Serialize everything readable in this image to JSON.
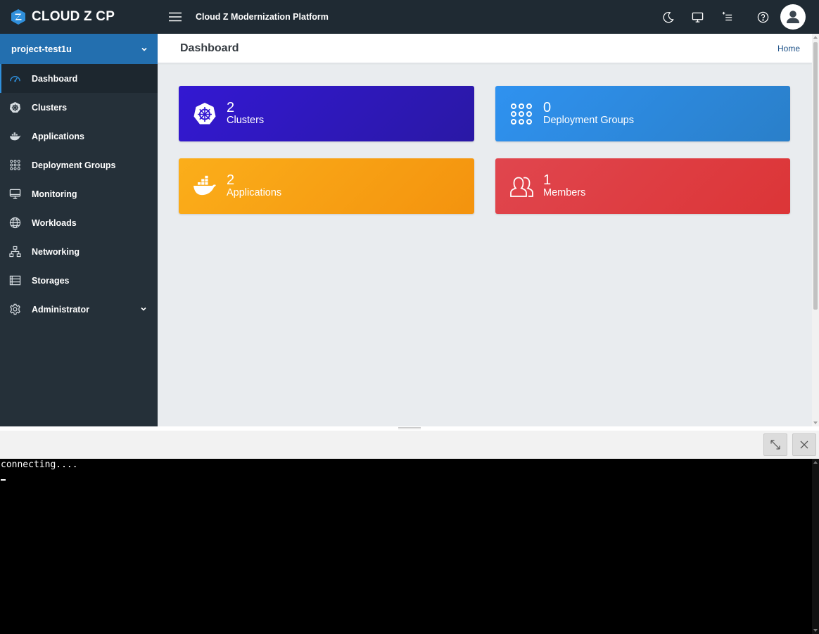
{
  "brand": {
    "name": "CLOUD Z CP",
    "logo_letter": "Z",
    "logo_color": "#2f8fdb"
  },
  "sidebar": {
    "project": {
      "label": "project-test1u"
    },
    "items": [
      {
        "label": "Dashboard",
        "icon": "gauge-icon",
        "active": true
      },
      {
        "label": "Clusters",
        "icon": "kubernetes-icon"
      },
      {
        "label": "Applications",
        "icon": "docker-icon"
      },
      {
        "label": "Deployment Groups",
        "icon": "dots-grid-icon"
      },
      {
        "label": "Monitoring",
        "icon": "monitor-icon"
      },
      {
        "label": "Workloads",
        "icon": "globe-icon"
      },
      {
        "label": "Networking",
        "icon": "network-icon"
      },
      {
        "label": "Storages",
        "icon": "storage-icon"
      },
      {
        "label": "Administrator",
        "icon": "gear-icon",
        "expandable": true
      }
    ]
  },
  "header": {
    "title": "Cloud Z Modernization Platform",
    "icons": [
      "moon-icon",
      "monitor-icon",
      "list-add-icon",
      "help-icon",
      "user-avatar-icon"
    ]
  },
  "content": {
    "page_title": "Dashboard",
    "breadcrumb": "Home",
    "cards": [
      {
        "count": "2",
        "label": "Clusters",
        "icon": "kubernetes-icon",
        "color": "#3318d2"
      },
      {
        "count": "0",
        "label": "Deployment Groups",
        "icon": "dots-grid-icon",
        "color": "#2f92f0"
      },
      {
        "count": "2",
        "label": "Applications",
        "icon": "docker-icon",
        "color": "#fbae1a"
      },
      {
        "count": "1",
        "label": "Members",
        "icon": "users-icon",
        "color": "#e0464e"
      }
    ]
  },
  "terminal": {
    "output": "connecting....",
    "buttons": [
      "expand-icon",
      "close-icon"
    ]
  }
}
